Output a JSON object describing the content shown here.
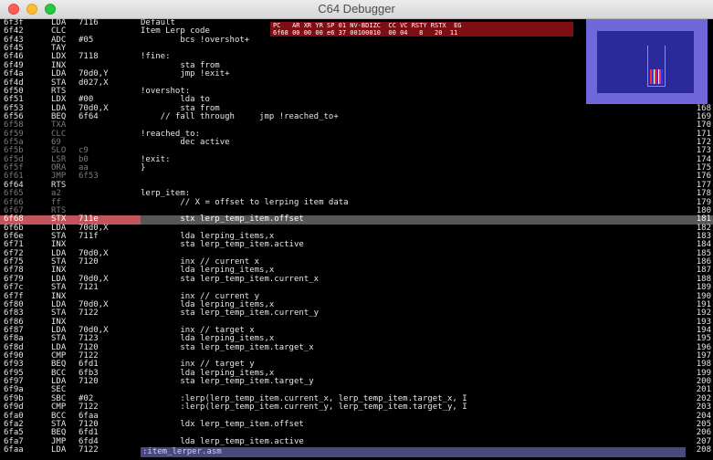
{
  "window": {
    "title": "C64 Debugger"
  },
  "registers": {
    "header": "PC   AR XR YR SP 01 NV-BDIZC  CC VC RSTY RSTX  EG",
    "values": "6f68 00 00 00 e6 37 00100010  00 04   8   20  11"
  },
  "preview": {
    "label": "C64 screen preview"
  },
  "disasm": [
    {
      "addr": "6f3f",
      "mn": "LDA",
      "op": "7116",
      "dim": false,
      "cur": false
    },
    {
      "addr": "6f42",
      "mn": "CLC",
      "op": "",
      "dim": false,
      "cur": false
    },
    {
      "addr": "6f43",
      "mn": "ADC",
      "op": "#05",
      "dim": false,
      "cur": false
    },
    {
      "addr": "6f45",
      "mn": "TAY",
      "op": "",
      "dim": false,
      "cur": false
    },
    {
      "addr": "6f46",
      "mn": "LDX",
      "op": "7118",
      "dim": false,
      "cur": false
    },
    {
      "addr": "6f49",
      "mn": "INX",
      "op": "",
      "dim": false,
      "cur": false
    },
    {
      "addr": "6f4a",
      "mn": "LDA",
      "op": "70d0,Y",
      "dim": false,
      "cur": false
    },
    {
      "addr": "6f4d",
      "mn": "STA",
      "op": "d027,X",
      "dim": false,
      "cur": false
    },
    {
      "addr": "6f50",
      "mn": "RTS",
      "op": "",
      "dim": false,
      "cur": false
    },
    {
      "addr": "6f51",
      "mn": "LDX",
      "op": "#00",
      "dim": false,
      "cur": false
    },
    {
      "addr": "6f53",
      "mn": "LDA",
      "op": "70d0,X",
      "dim": false,
      "cur": false
    },
    {
      "addr": "6f56",
      "mn": "BEQ",
      "op": "6f64",
      "dim": false,
      "cur": false
    },
    {
      "addr": "6f58",
      "mn": "TXA",
      "op": "",
      "dim": true,
      "cur": false
    },
    {
      "addr": "6f59",
      "mn": "CLC",
      "op": "",
      "dim": true,
      "cur": false
    },
    {
      "addr": "6f5a",
      "mn": "69",
      "op": "",
      "dim": true,
      "cur": false
    },
    {
      "addr": "6f5b",
      "mn": "SLO",
      "op": "c9",
      "dim": true,
      "cur": false
    },
    {
      "addr": "6f5d",
      "mn": "LSR",
      "op": "b0",
      "dim": true,
      "cur": false
    },
    {
      "addr": "6f5f",
      "mn": "ORA",
      "op": "aa",
      "dim": true,
      "cur": false
    },
    {
      "addr": "6f61",
      "mn": "JMP",
      "op": "6f53",
      "dim": true,
      "cur": false
    },
    {
      "addr": "6f64",
      "mn": "RTS",
      "op": "",
      "dim": false,
      "cur": false
    },
    {
      "addr": "6f65",
      "mn": "a2",
      "op": "",
      "dim": true,
      "cur": false
    },
    {
      "addr": "6f66",
      "mn": "ff",
      "op": "",
      "dim": true,
      "cur": false
    },
    {
      "addr": "6f67",
      "mn": "RTS",
      "op": "",
      "dim": true,
      "cur": false
    },
    {
      "addr": "6f68",
      "mn": "STX",
      "op": "711e",
      "dim": false,
      "cur": true
    },
    {
      "addr": "6f6b",
      "mn": "LDA",
      "op": "70d0,X",
      "dim": false,
      "cur": false
    },
    {
      "addr": "6f6e",
      "mn": "STA",
      "op": "711f",
      "dim": false,
      "cur": false
    },
    {
      "addr": "6f71",
      "mn": "INX",
      "op": "",
      "dim": false,
      "cur": false
    },
    {
      "addr": "6f72",
      "mn": "LDA",
      "op": "70d0,X",
      "dim": false,
      "cur": false
    },
    {
      "addr": "6f75",
      "mn": "STA",
      "op": "7120",
      "dim": false,
      "cur": false
    },
    {
      "addr": "6f78",
      "mn": "INX",
      "op": "",
      "dim": false,
      "cur": false
    },
    {
      "addr": "6f79",
      "mn": "LDA",
      "op": "70d0,X",
      "dim": false,
      "cur": false
    },
    {
      "addr": "6f7c",
      "mn": "STA",
      "op": "7121",
      "dim": false,
      "cur": false
    },
    {
      "addr": "6f7f",
      "mn": "INX",
      "op": "",
      "dim": false,
      "cur": false
    },
    {
      "addr": "6f80",
      "mn": "LDA",
      "op": "70d0,X",
      "dim": false,
      "cur": false
    },
    {
      "addr": "6f83",
      "mn": "STA",
      "op": "7122",
      "dim": false,
      "cur": false
    },
    {
      "addr": "6f86",
      "mn": "INX",
      "op": "",
      "dim": false,
      "cur": false
    },
    {
      "addr": "6f87",
      "mn": "LDA",
      "op": "70d0,X",
      "dim": false,
      "cur": false
    },
    {
      "addr": "6f8a",
      "mn": "STA",
      "op": "7123",
      "dim": false,
      "cur": false
    },
    {
      "addr": "6f8d",
      "mn": "LDA",
      "op": "7120",
      "dim": false,
      "cur": false
    },
    {
      "addr": "6f90",
      "mn": "CMP",
      "op": "7122",
      "dim": false,
      "cur": false
    },
    {
      "addr": "6f93",
      "mn": "BEQ",
      "op": "6fd1",
      "dim": false,
      "cur": false
    },
    {
      "addr": "6f95",
      "mn": "BCC",
      "op": "6fb3",
      "dim": false,
      "cur": false
    },
    {
      "addr": "6f97",
      "mn": "LDA",
      "op": "7120",
      "dim": false,
      "cur": false
    },
    {
      "addr": "6f9a",
      "mn": "SEC",
      "op": "",
      "dim": false,
      "cur": false
    },
    {
      "addr": "6f9b",
      "mn": "SBC",
      "op": "#02",
      "dim": false,
      "cur": false
    },
    {
      "addr": "6f9d",
      "mn": "CMP",
      "op": "7122",
      "dim": false,
      "cur": false
    },
    {
      "addr": "6fa0",
      "mn": "BCC",
      "op": "6faa",
      "dim": false,
      "cur": false
    },
    {
      "addr": "6fa2",
      "mn": "STA",
      "op": "7120",
      "dim": false,
      "cur": false
    },
    {
      "addr": "6fa5",
      "mn": "BEQ",
      "op": "6fd1",
      "dim": false,
      "cur": false
    },
    {
      "addr": "6fa7",
      "mn": "JMP",
      "op": "6fd4",
      "dim": false,
      "cur": false
    },
    {
      "addr": "6faa",
      "mn": "LDA",
      "op": "7122",
      "dim": false,
      "cur": false
    }
  ],
  "source": [
    {
      "text": "Default",
      "cur": false
    },
    {
      "text": "Item Lerp code",
      "cur": false
    },
    {
      "text": "        bcs !overshot+",
      "cur": false
    },
    {
      "text": "",
      "cur": false
    },
    {
      "text": "!fine:",
      "cur": false
    },
    {
      "text": "        sta from",
      "cur": false
    },
    {
      "text": "        jmp !exit+",
      "cur": false
    },
    {
      "text": "",
      "cur": false
    },
    {
      "text": "!overshot:",
      "cur": false
    },
    {
      "text": "        lda to",
      "cur": false
    },
    {
      "text": "        sta from",
      "cur": false
    },
    {
      "text": "    // fall through     jmp !reached_to+",
      "cur": false
    },
    {
      "text": "",
      "cur": false
    },
    {
      "text": "!reached_to:",
      "cur": false
    },
    {
      "text": "        dec active",
      "cur": false
    },
    {
      "text": "",
      "cur": false
    },
    {
      "text": "!exit:",
      "cur": false
    },
    {
      "text": "}",
      "cur": false
    },
    {
      "text": "",
      "cur": false
    },
    {
      "text": "",
      "cur": false
    },
    {
      "text": "lerp_item:",
      "cur": false
    },
    {
      "text": "        // X = offset to lerping item data",
      "cur": false
    },
    {
      "text": "",
      "cur": false
    },
    {
      "text": "        stx lerp_temp_item.offset",
      "cur": true
    },
    {
      "text": "",
      "cur": false
    },
    {
      "text": "        lda lerping_items,x",
      "cur": false
    },
    {
      "text": "        sta lerp_temp_item.active",
      "cur": false
    },
    {
      "text": "",
      "cur": false
    },
    {
      "text": "        inx // current x",
      "cur": false
    },
    {
      "text": "        lda lerping_items,x",
      "cur": false
    },
    {
      "text": "        sta lerp_temp_item.current_x",
      "cur": false
    },
    {
      "text": "",
      "cur": false
    },
    {
      "text": "        inx // current y",
      "cur": false
    },
    {
      "text": "        lda lerping_items,x",
      "cur": false
    },
    {
      "text": "        sta lerp_temp_item.current_y",
      "cur": false
    },
    {
      "text": "",
      "cur": false
    },
    {
      "text": "        inx // target x",
      "cur": false
    },
    {
      "text": "        lda lerping_items,x",
      "cur": false
    },
    {
      "text": "        sta lerp_temp_item.target_x",
      "cur": false
    },
    {
      "text": "",
      "cur": false
    },
    {
      "text": "        inx // target y",
      "cur": false
    },
    {
      "text": "        lda lerping_items,x",
      "cur": false
    },
    {
      "text": "        sta lerp_temp_item.target_y",
      "cur": false
    },
    {
      "text": "",
      "cur": false
    },
    {
      "text": "        :lerp(lerp_temp_item.current_x, lerp_temp_item.target_x, I",
      "cur": false
    },
    {
      "text": "        :lerp(lerp_temp_item.current_y, lerp_temp_item.target_y, I",
      "cur": false
    },
    {
      "text": "",
      "cur": false
    },
    {
      "text": "        ldx lerp_temp_item.offset",
      "cur": false
    },
    {
      "text": "",
      "cur": false
    },
    {
      "text": "        lda lerp_temp_item.active",
      "cur": false
    }
  ],
  "linenums": [
    {
      "n": "",
      "cur": false
    },
    {
      "n": "",
      "cur": false
    },
    {
      "n": "",
      "cur": false
    },
    {
      "n": "",
      "cur": false
    },
    {
      "n": "",
      "cur": false
    },
    {
      "n": "",
      "cur": false
    },
    {
      "n": "",
      "cur": false
    },
    {
      "n": "",
      "cur": false
    },
    {
      "n": "",
      "cur": false
    },
    {
      "n": "",
      "cur": false
    },
    {
      "n": "168",
      "cur": false
    },
    {
      "n": "169",
      "cur": false
    },
    {
      "n": "170",
      "cur": false
    },
    {
      "n": "171",
      "cur": false
    },
    {
      "n": "172",
      "cur": false
    },
    {
      "n": "173",
      "cur": false
    },
    {
      "n": "174",
      "cur": false
    },
    {
      "n": "175",
      "cur": false
    },
    {
      "n": "176",
      "cur": false
    },
    {
      "n": "177",
      "cur": false
    },
    {
      "n": "178",
      "cur": false
    },
    {
      "n": "179",
      "cur": false
    },
    {
      "n": "180",
      "cur": false
    },
    {
      "n": "181",
      "cur": true
    },
    {
      "n": "182",
      "cur": false
    },
    {
      "n": "183",
      "cur": false
    },
    {
      "n": "184",
      "cur": false
    },
    {
      "n": "185",
      "cur": false
    },
    {
      "n": "186",
      "cur": false
    },
    {
      "n": "187",
      "cur": false
    },
    {
      "n": "188",
      "cur": false
    },
    {
      "n": "189",
      "cur": false
    },
    {
      "n": "190",
      "cur": false
    },
    {
      "n": "191",
      "cur": false
    },
    {
      "n": "192",
      "cur": false
    },
    {
      "n": "193",
      "cur": false
    },
    {
      "n": "194",
      "cur": false
    },
    {
      "n": "195",
      "cur": false
    },
    {
      "n": "196",
      "cur": false
    },
    {
      "n": "197",
      "cur": false
    },
    {
      "n": "198",
      "cur": false
    },
    {
      "n": "199",
      "cur": false
    },
    {
      "n": "200",
      "cur": false
    },
    {
      "n": "201",
      "cur": false
    },
    {
      "n": "202",
      "cur": false
    },
    {
      "n": "203",
      "cur": false
    },
    {
      "n": "204",
      "cur": false
    },
    {
      "n": "205",
      "cur": false
    },
    {
      "n": "206",
      "cur": false
    },
    {
      "n": "207",
      "cur": false
    },
    {
      "n": "208",
      "cur": false
    }
  ],
  "status": {
    "filename": ":item_lerper.asm"
  }
}
